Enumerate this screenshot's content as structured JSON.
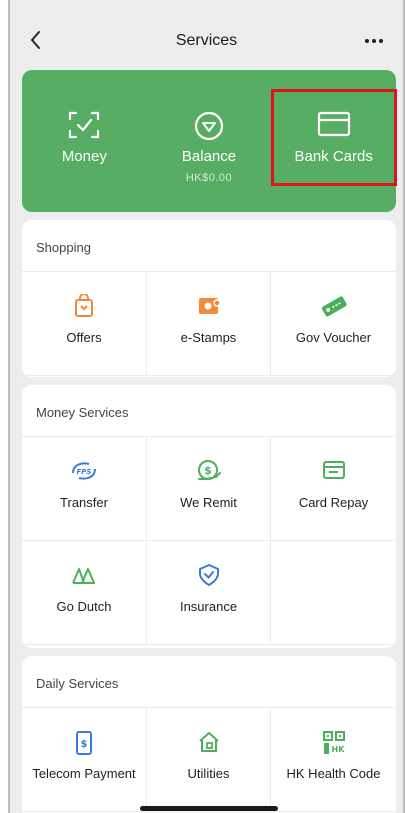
{
  "nav": {
    "title": "Services"
  },
  "top_card": {
    "items": [
      {
        "label": "Money",
        "sub": ""
      },
      {
        "label": "Balance",
        "sub": "HK$0.00"
      },
      {
        "label": "Bank Cards",
        "sub": ""
      }
    ]
  },
  "shopping": {
    "title": "Shopping",
    "items": [
      {
        "label": "Offers",
        "icon": "offers-bag-icon",
        "color": "#f08a3c"
      },
      {
        "label": "e-Stamps",
        "icon": "e-stamps-icon",
        "color": "#f08a3c"
      },
      {
        "label": "Gov Voucher",
        "icon": "voucher-ticket-icon",
        "color": "#4caf5c"
      }
    ]
  },
  "money_services": {
    "title": "Money Services",
    "items": [
      {
        "label": "Transfer",
        "icon": "fps-transfer-icon",
        "color": "#3a7bd5"
      },
      {
        "label": "We Remit",
        "icon": "remit-icon",
        "color": "#4caf5c"
      },
      {
        "label": "Card Repay",
        "icon": "card-repay-icon",
        "color": "#4caf5c"
      },
      {
        "label": "Go Dutch",
        "icon": "go-dutch-icon",
        "color": "#4caf5c"
      },
      {
        "label": "Insurance",
        "icon": "shield-icon",
        "color": "#3a7bd5"
      }
    ]
  },
  "daily_services": {
    "title": "Daily Services",
    "items": [
      {
        "label": "Telecom Payment",
        "icon": "phone-dollar-icon",
        "color": "#3a7bd5"
      },
      {
        "label": "Utilities",
        "icon": "home-utility-icon",
        "color": "#4caf5c"
      },
      {
        "label": "HK Health Code",
        "icon": "qr-code-icon",
        "color": "#4caf5c"
      }
    ]
  }
}
